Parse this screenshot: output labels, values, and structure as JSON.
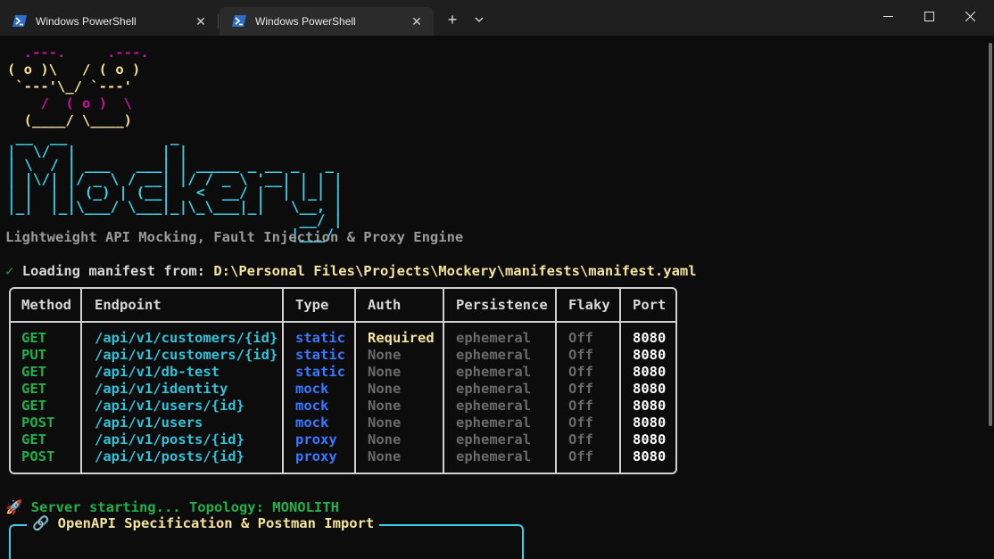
{
  "tabs": [
    {
      "title": "Windows PowerShell",
      "icon": "powershell-icon",
      "close": "✕"
    },
    {
      "title": "Windows PowerShell",
      "icon": "powershell-icon",
      "close": "✕"
    }
  ],
  "titlebar": {
    "new_tab": "+",
    "dropdown": "⌄"
  },
  "colors": {
    "background": "#0c0c0c",
    "cyan": "#3ad0e8",
    "green": "#22b04a",
    "yellow": "#f5e39c",
    "blue": "#3b78ff",
    "magenta": "#c8109c"
  },
  "banner": {
    "robot_lines": [
      [
        {
          "t": "  ",
          "c": "yellow"
        },
        {
          "t": ".---.",
          "c": "magenta"
        },
        {
          "t": "     ",
          "c": "yellow"
        },
        {
          "t": ".---.",
          "c": "magenta"
        }
      ],
      [
        {
          "t": "( o )\\   / ( o )",
          "c": "yellow"
        }
      ],
      [
        {
          "t": " `---'\\_/ `---'",
          "c": "yellow"
        }
      ],
      [
        {
          "t": "    ",
          "c": "yellow"
        },
        {
          "t": "/  ( o )  \\",
          "c": "magenta"
        }
      ],
      [
        {
          "t": "  (____/ \\____)",
          "c": "yellow"
        }
      ]
    ],
    "logo_lines": [
      " __  __            _",
      "|  \\/  |          | |",
      "| \\  / | ___   ___| | _____ _ __ _   _",
      "| |\\/| |/ _ \\ / __| |/ / _ \\ '__| | | |",
      "| |  | | (_) | (__|   <  __/ |  | |_| |",
      "|_|  |_|\\___/ \\___|_|\\_\\___|_|   \\__, |",
      "                                  __/ |",
      "                                 |___/"
    ],
    "subtitle": "Lightweight API Mocking, Fault Injection & Proxy Engine"
  },
  "manifest": {
    "check": "✓",
    "label": "Loading manifest from: ",
    "path": "D:\\Personal Files\\Projects\\Mockery\\manifests\\manifest.yaml"
  },
  "table": {
    "headers": [
      "Method",
      "Endpoint",
      "Type",
      "Auth",
      "Persistence",
      "Flaky",
      "Port"
    ],
    "rows": [
      {
        "method": "GET",
        "endpoint": "/api/v1/customers/{id}",
        "type": "static",
        "auth": "Required",
        "persistence": "ephemeral",
        "flaky": "Off",
        "port": "8080"
      },
      {
        "method": "PUT",
        "endpoint": "/api/v1/customers/{id}",
        "type": "static",
        "auth": "None",
        "persistence": "ephemeral",
        "flaky": "Off",
        "port": "8080"
      },
      {
        "method": "GET",
        "endpoint": "/api/v1/db-test",
        "type": "static",
        "auth": "None",
        "persistence": "ephemeral",
        "flaky": "Off",
        "port": "8080"
      },
      {
        "method": "GET",
        "endpoint": "/api/v1/identity",
        "type": "mock",
        "auth": "None",
        "persistence": "ephemeral",
        "flaky": "Off",
        "port": "8080"
      },
      {
        "method": "GET",
        "endpoint": "/api/v1/users/{id}",
        "type": "mock",
        "auth": "None",
        "persistence": "ephemeral",
        "flaky": "Off",
        "port": "8080"
      },
      {
        "method": "POST",
        "endpoint": "/api/v1/users",
        "type": "mock",
        "auth": "None",
        "persistence": "ephemeral",
        "flaky": "Off",
        "port": "8080"
      },
      {
        "method": "GET",
        "endpoint": "/api/v1/posts/{id}",
        "type": "proxy",
        "auth": "None",
        "persistence": "ephemeral",
        "flaky": "Off",
        "port": "8080"
      },
      {
        "method": "POST",
        "endpoint": "/api/v1/posts/{id}",
        "type": "proxy",
        "auth": "None",
        "persistence": "ephemeral",
        "flaky": "Off",
        "port": "8080"
      }
    ]
  },
  "server": {
    "icon": "rocket-icon",
    "emoji": "🚀",
    "text": "Server starting... Topology: MONOLITH"
  },
  "openapi": {
    "icon": "link-icon",
    "emoji": "🔗",
    "title": "OpenAPI Specification & Postman Import"
  }
}
